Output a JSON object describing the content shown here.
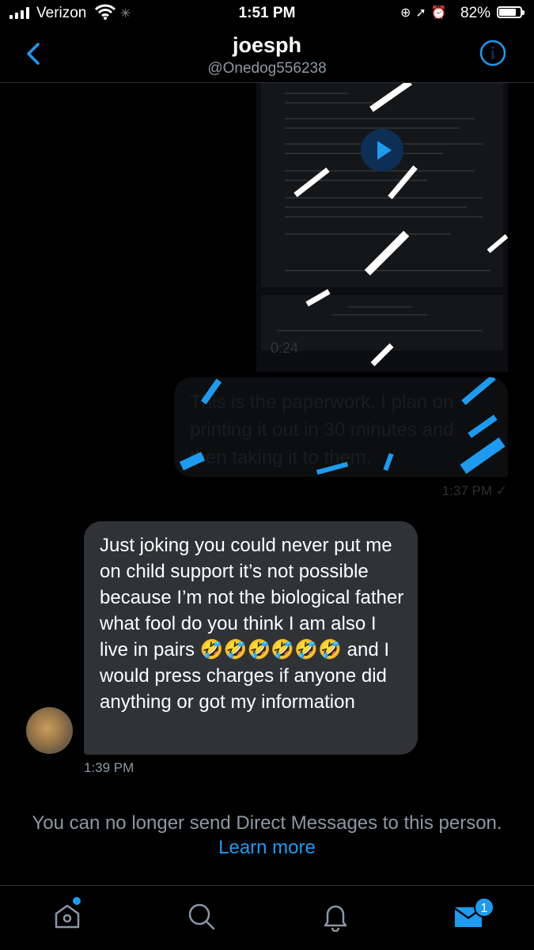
{
  "status_bar": {
    "carrier": "Verizon",
    "time": "1:51 PM",
    "battery": "82%",
    "battery_level": 0.82
  },
  "header": {
    "name": "joesph",
    "handle": "@Onedog556238"
  },
  "messages": {
    "media_duration": "0:24",
    "sent_text": "This is the paperwork. I plan on printing it out in 30 minutes and then taking it to them.",
    "sent_time": "1:37 PM ✓",
    "received_text": "Just joking you could never put me on child support it’s not possible because I’m not the biological father what fool do you think I am  also I live in pairs 🤣🤣🤣🤣🤣🤣 and I would press charges if anyone did anything or got my information",
    "received_time": "1:39 PM"
  },
  "notice": {
    "text": "You can no longer send Direct Messages to this person.",
    "link": "Learn more"
  },
  "tabbar": {
    "messages_badge": "1"
  },
  "colors": {
    "accent": "#1d9bf0",
    "bubble_received": "#2f3336",
    "secondary_text": "#8b98a5"
  }
}
